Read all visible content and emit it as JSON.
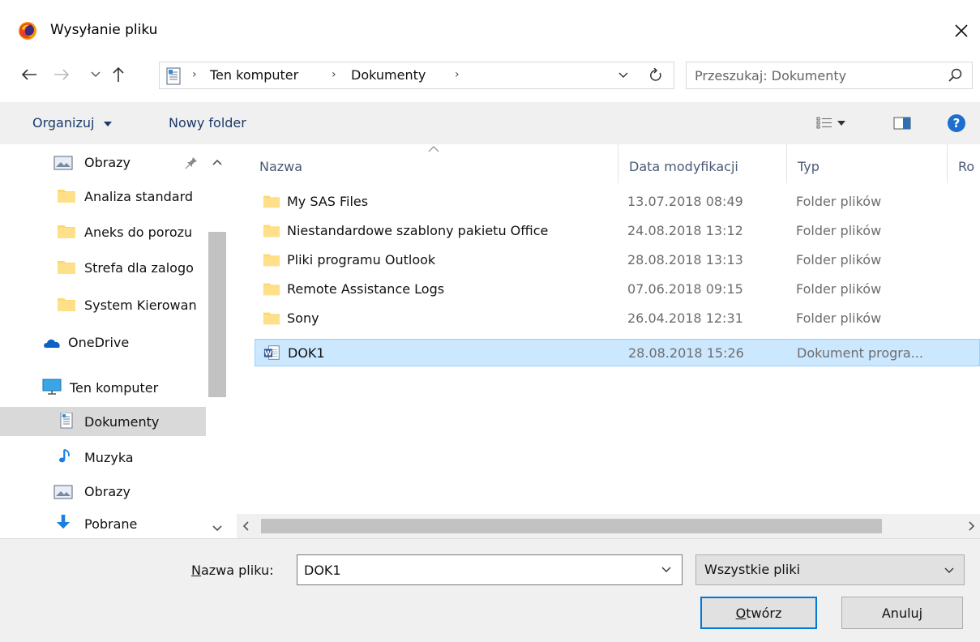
{
  "window": {
    "title": "Wysyłanie pliku"
  },
  "address_bar": {
    "crumbs": [
      "Ten komputer",
      "Dokumenty"
    ]
  },
  "search": {
    "placeholder": "Przeszukaj: Dokumenty"
  },
  "toolbar": {
    "organize_label": "Organizuj",
    "new_folder_label": "Nowy folder"
  },
  "nav": {
    "items": [
      {
        "label": "Obrazy",
        "icon": "pictures-icon"
      },
      {
        "label": "Analiza standard",
        "icon": "folder-icon"
      },
      {
        "label": "Aneks do porozu",
        "icon": "folder-icon"
      },
      {
        "label": "Strefa dla zalogo",
        "icon": "folder-icon"
      },
      {
        "label": "System Kierowan",
        "icon": "folder-icon"
      },
      {
        "label": "OneDrive",
        "icon": "onedrive-icon"
      },
      {
        "label": "Ten komputer",
        "icon": "computer-icon"
      },
      {
        "label": "Dokumenty",
        "icon": "documents-icon"
      },
      {
        "label": "Muzyka",
        "icon": "music-icon"
      },
      {
        "label": "Obrazy",
        "icon": "pictures-icon"
      },
      {
        "label": "Pobrane",
        "icon": "downloads-icon"
      }
    ]
  },
  "files": {
    "columns": [
      "Nazwa",
      "Data modyfikacji",
      "Typ",
      "Ro"
    ],
    "rows": [
      {
        "name": "My SAS Files",
        "date": "13.07.2018 08:49",
        "type": "Folder plików",
        "icon": "folder-icon"
      },
      {
        "name": "Niestandardowe szablony pakietu Office",
        "date": "24.08.2018 13:12",
        "type": "Folder plików",
        "icon": "folder-icon"
      },
      {
        "name": "Pliki programu Outlook",
        "date": "28.08.2018 13:13",
        "type": "Folder plików",
        "icon": "folder-icon"
      },
      {
        "name": "Remote Assistance Logs",
        "date": "07.06.2018 09:15",
        "type": "Folder plików",
        "icon": "folder-icon"
      },
      {
        "name": "Sony",
        "date": "26.04.2018 12:31",
        "type": "Folder plików",
        "icon": "folder-icon"
      },
      {
        "name": "DOK1",
        "date": "28.08.2018 15:26",
        "type": "Dokument progra...",
        "icon": "word-doc-icon"
      }
    ]
  },
  "bottom": {
    "filename_label_mnemonic": "N",
    "filename_label_rest": "azwa pliku:",
    "filename_value": "DOK1",
    "filter_value": "Wszystkie pliki",
    "open_mnemonic": "O",
    "open_rest": "twórz",
    "cancel_label": "Anuluj"
  },
  "colors": {
    "selection_bg": "#cce8ff",
    "selection_border": "#99d1ff",
    "accent": "#0078d7"
  }
}
